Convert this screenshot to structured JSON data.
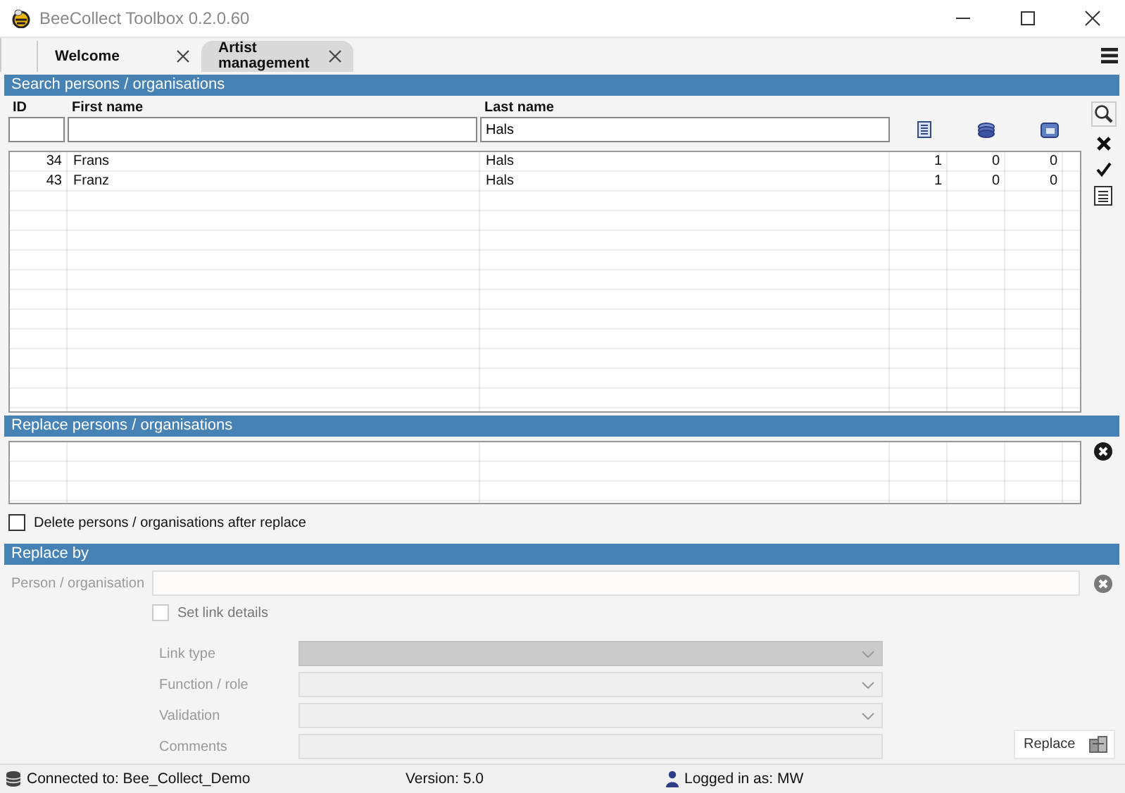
{
  "window": {
    "title": "BeeCollect Toolbox 0.2.0.60"
  },
  "tabs": [
    {
      "label": "Welcome",
      "selected": false
    },
    {
      "label": "Artist management",
      "selected": true
    }
  ],
  "search": {
    "title": "Search persons / organisations",
    "fields": [
      {
        "label": "ID"
      },
      {
        "label": "First name"
      },
      {
        "label": "Last name",
        "value": "Hals"
      }
    ],
    "rows": [
      {
        "id": "34",
        "first_name": "Frans",
        "last_name": "Hals",
        "count_1": "1",
        "count_2": "0",
        "count_3": "0"
      },
      {
        "id": "43",
        "first_name": "Franz",
        "last_name": "Hals",
        "count_1": "1",
        "count_2": "0",
        "count_3": "0"
      }
    ]
  },
  "replace": {
    "title": "Replace persons / organisations",
    "delete_after": {
      "label": "Delete persons / organisations after replace",
      "checked": false
    }
  },
  "replace_by": {
    "title": "Replace by",
    "person_label": "Person / organisation",
    "set_link_details": {
      "label": "Set link details",
      "checked": false
    },
    "fields": [
      {
        "label": "Link type",
        "kind": "select",
        "disabled": true
      },
      {
        "label": "Function / role",
        "kind": "select",
        "disabled": false
      },
      {
        "label": "Validation",
        "kind": "select",
        "disabled": false
      },
      {
        "label": "Comments",
        "kind": "text",
        "disabled": false
      }
    ],
    "button": "Replace"
  },
  "status_bar": {
    "connection": "Connected to: Bee_Collect_Demo",
    "version": "Version: 5.0",
    "user": "Logged in as: MW"
  }
}
